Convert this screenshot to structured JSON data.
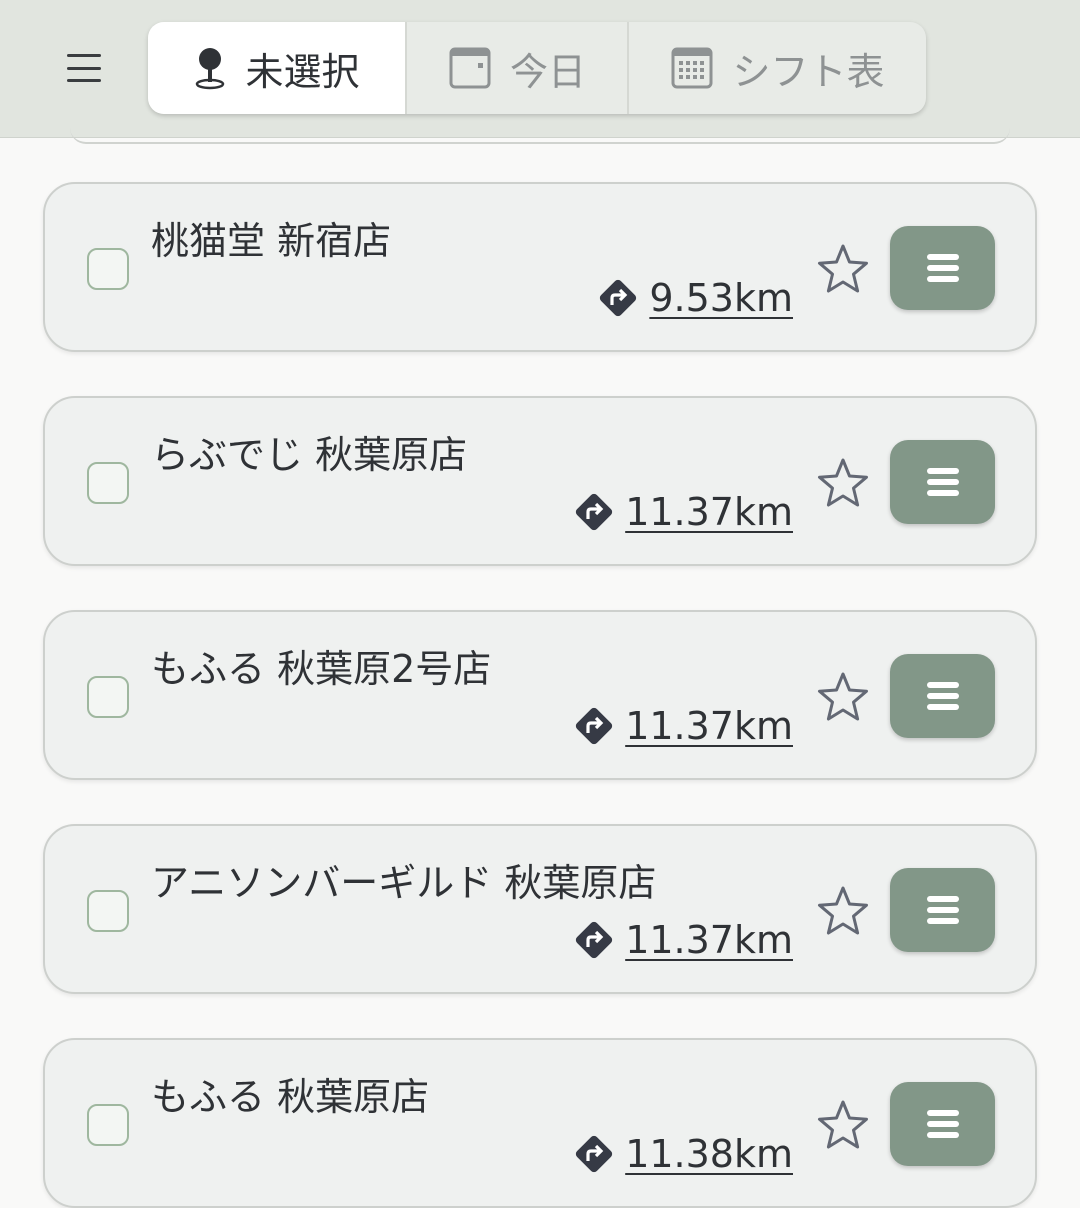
{
  "header": {
    "tabs": [
      {
        "label": "未選択",
        "icon": "map-pin-icon",
        "active": true
      },
      {
        "label": "今日",
        "icon": "calendar-day-icon",
        "active": false
      },
      {
        "label": "シフト表",
        "icon": "calendar-grid-icon",
        "active": false
      }
    ]
  },
  "stores": [
    {
      "name": "桃猫堂 新宿店",
      "distance": "9.53km"
    },
    {
      "name": "らぶでじ 秋葉原店",
      "distance": "11.37km"
    },
    {
      "name": "もふる 秋葉原2号店",
      "distance": "11.37km"
    },
    {
      "name": "アニソンバーギルド 秋葉原店",
      "distance": "11.37km"
    },
    {
      "name": "もふる 秋葉原店",
      "distance": "11.38km"
    }
  ],
  "colors": {
    "header_bg": "#e1e5df",
    "card_bg": "#eff1f0",
    "action_button": "#829788",
    "checkbox_border": "#9fb79f"
  }
}
